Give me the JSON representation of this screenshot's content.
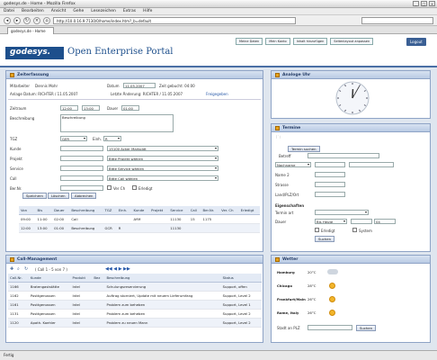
{
  "window": {
    "title": "godesys.de - Home - Mozilla Firefox"
  },
  "menu": [
    "Datei",
    "Bearbeiten",
    "Ansicht",
    "Gehe",
    "Lesezeichen",
    "Extras",
    "Hilfe"
  ],
  "browser": {
    "url": "http://10.0.16.9:7130/0/home/index.htm?_b=default",
    "tab": "godesys.de - Home"
  },
  "header": {
    "logo": "godesys.",
    "title": "Open Enterprise Portal",
    "nav": [
      "Meine Daten",
      "Mein Konto",
      "Inhalt hinzufügen",
      "Seitenlayout anpassen"
    ],
    "logout": "Logout"
  },
  "time": {
    "title": "Zeiterfassung",
    "mitarbeiter_label": "Mitarbeiter",
    "mitarbeiter": "Dennis Mohr",
    "datum_label": "Datum",
    "datum": "11.05.2007",
    "zeit_gebucht": "Zeit gebucht: 04:00",
    "anlage": "Anlage Datum: RICHTER / 11.05.2007",
    "letzte": "Letzte Änderung: RICHTER / 11.05.2007",
    "freigabe": "Freigegeben",
    "zeitraum_label": "Zeitraum",
    "von": "12:00",
    "bis": "13:00",
    "dauer_label": "Dauer",
    "dauer": "01:00",
    "beschreibung_label": "Beschreibung",
    "beschreibung": "Beschreibung",
    "tgz_label": "TGZ",
    "tgz": "GER",
    "einh_label": "Einh.",
    "einh": "R",
    "kunde_label": "Kunde",
    "kunde": "15100 Acker Markoldt",
    "projekt_label": "Projekt",
    "projekt": "Bitte Projekt wählen",
    "service_label": "Service",
    "service": "Bitte Service wählen",
    "call_label": "Call",
    "call": "Bitte Call wählen",
    "bericht_label": "Ber.Nr.",
    "verrech": "Ver Ch",
    "erledigt": "Erledigt",
    "btn_speichern": "Speichern",
    "btn_loeschen": "Löschen",
    "btn_abbrechen": "Abbrechen",
    "columns": [
      "Von",
      "Bis",
      "Dauer",
      "Beschreibung",
      "TGZ",
      "Einh.",
      "Kunde",
      "Projekt",
      "Service",
      "Call",
      "Ber.Nr.",
      "Ver. Ch",
      "Erledigt"
    ],
    "rows": [
      [
        "09:00",
        "11:00",
        "02:00",
        "Call",
        "",
        "",
        "AYM",
        "",
        "11130",
        "15",
        "1175",
        "",
        ""
      ],
      [
        "12:00",
        "13:00",
        "01:00",
        "Beschreibung",
        "GCR",
        "R",
        "",
        "",
        "11130",
        "",
        "",
        "",
        ""
      ]
    ]
  },
  "clock": {
    "title": "Analoge Uhr",
    "hour": 12,
    "minute": 5
  },
  "termine": {
    "title": "Termine",
    "neu": "Termin suchen",
    "betreff_label": "Betreff",
    "fields": [
      "Nachname",
      "Name 2",
      "Strasse",
      "Land/PLZ/Ort"
    ],
    "eigenschaften": "Eigenschaften",
    "termin_art": "Termin art",
    "dauer_label": "Dauer",
    "von": "Bis Heute",
    "bis": "04",
    "erledigt": "Erledigt",
    "system": "System",
    "suchen": "Suchen"
  },
  "calls": {
    "title": "Call-Management",
    "paging": "( Call 1 - 5 von 7 )",
    "columns": [
      "Call-Nr.",
      "Kunde",
      "Produkt",
      "Bez",
      "Beschreibung",
      "Status"
    ],
    "rows": [
      [
        "1166",
        "Bratengaststätte",
        "Intel",
        "Schulungsreservierung",
        "Support, offen"
      ],
      [
        "1162",
        "Posttgenossen",
        "Intel",
        "Auftrag storniert, Update mit neuem Lieferumfang",
        "Support, Level 2"
      ],
      [
        "1161",
        "Posttgenossen",
        "Intel",
        "Problem zum beheben",
        "Support, Level 1"
      ],
      [
        "1131",
        "Posttgenossen",
        "Intel",
        "Problem zum beheben",
        "Support, Level 2"
      ],
      [
        "1120",
        "Apoth. Koehler",
        "Intel",
        "Problem zu neuen Mann",
        "Support, Level 2"
      ]
    ]
  },
  "weather": {
    "title": "Wetter",
    "cities": [
      {
        "name": "Hamburg",
        "temp": "20°C"
      },
      {
        "name": "Chicago",
        "temp": "28°C"
      },
      {
        "name": "Frankfurt/Main",
        "temp": "26°C"
      },
      {
        "name": "Rome, Italy",
        "temp": "26°C"
      }
    ],
    "search_label": "Stadt an PLZ",
    "search_btn": "Suchen"
  },
  "status": "Fertig"
}
